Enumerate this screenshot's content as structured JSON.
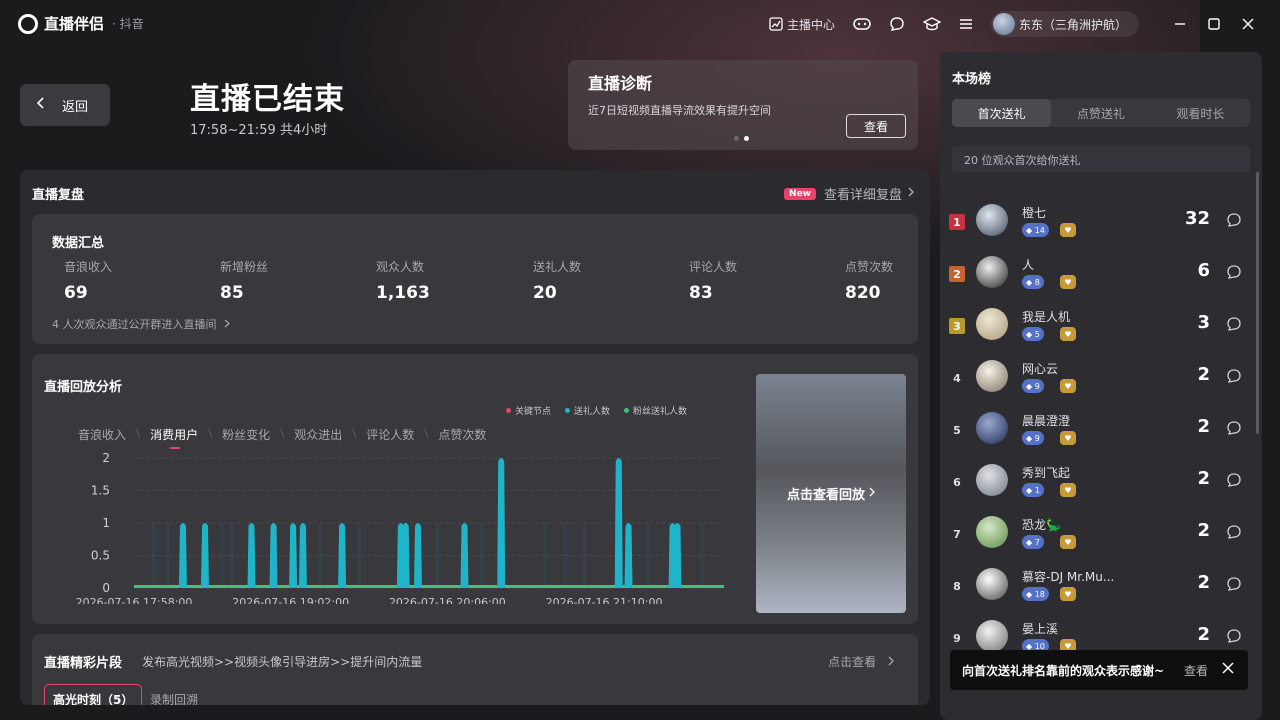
{
  "app": {
    "name": "直播伴侣",
    "platform": "· 抖音"
  },
  "titlebar": {
    "host_center": "主播中心",
    "user_name": "东东（三角洲护航）"
  },
  "back_label": "返回",
  "status": {
    "title": "直播已结束",
    "time_range": "17:58~21:59 共4小时"
  },
  "diagnosis": {
    "title": "直播诊断",
    "desc": "近7日短视频直播导流效果有提升空间",
    "button": "查看"
  },
  "review": {
    "title": "直播复盘",
    "new_badge": "New",
    "detail_link": "查看详细复盘"
  },
  "summary": {
    "title": "数据汇总",
    "stats": [
      {
        "label": "音浪收入",
        "value": "69"
      },
      {
        "label": "新增粉丝",
        "value": "85"
      },
      {
        "label": "观众人数",
        "value": "1,163"
      },
      {
        "label": "送礼人数",
        "value": "20"
      },
      {
        "label": "评论人数",
        "value": "83"
      },
      {
        "label": "点赞次数",
        "value": "820"
      }
    ],
    "note": "4 人次观众通过公开群进入直播间"
  },
  "analysis": {
    "title": "直播回放分析",
    "legend": [
      "关键节点",
      "送礼人数",
      "粉丝送礼人数"
    ],
    "tabs": [
      "音浪收入",
      "消费用户",
      "粉丝变化",
      "观众进出",
      "评论人数",
      "点赞次数"
    ],
    "active_tab": "消费用户",
    "replay_label": "点击查看回放"
  },
  "chart_data": {
    "type": "area",
    "y_ticks": [
      "2",
      "1.5",
      "1",
      "0.5",
      "0"
    ],
    "x_ticks": [
      "2026-07-16 17:58:00",
      "2026-07-16 19:02:00",
      "2026-07-16 20:06:00",
      "2026-07-16 21:10:00"
    ],
    "ylim": [
      0,
      2
    ],
    "xlim_minutes_from_start": [
      0,
      241
    ],
    "series": [
      {
        "name": "送礼人数",
        "color": "#1fb4c8",
        "spikes": [
          [
            20,
            1
          ],
          [
            29,
            1
          ],
          [
            48,
            1
          ],
          [
            57,
            1
          ],
          [
            65,
            1
          ],
          [
            69,
            1
          ],
          [
            85,
            1
          ],
          [
            109,
            1
          ],
          [
            111,
            1
          ],
          [
            116,
            1
          ],
          [
            135,
            1
          ],
          [
            150,
            2
          ],
          [
            198,
            2
          ],
          [
            202,
            1
          ],
          [
            220,
            1
          ],
          [
            222,
            1
          ]
        ]
      },
      {
        "name": "粉丝送礼人数",
        "color": "#3fc27a",
        "spikes": []
      }
    ],
    "colors": {
      "key_node": "#e8436a",
      "gift": "#1fb4c8",
      "fan_gift": "#3fc27a"
    }
  },
  "highlights": {
    "title": "直播精彩片段",
    "desc": "发布高光视频>>视频头像引导进房>>提升间内流量",
    "link": "点击查看",
    "tab_active": "高光时刻（5）",
    "tab_other": "录制回溯"
  },
  "ranking": {
    "title": "本场榜",
    "tabs": [
      "首次送礼",
      "点赞送礼",
      "观看时长"
    ],
    "note": "20 位观众首次给你送礼",
    "rows": [
      {
        "rank": "1",
        "name": "橙七",
        "level": "14",
        "count": "32"
      },
      {
        "rank": "2",
        "name": "人",
        "level": "8",
        "count": "6"
      },
      {
        "rank": "3",
        "name": "我是人机",
        "level": "5",
        "count": "3"
      },
      {
        "rank": "4",
        "name": "网心云",
        "level": "9",
        "count": "2"
      },
      {
        "rank": "5",
        "name": "晨晨澄澄",
        "level": "9",
        "count": "2"
      },
      {
        "rank": "6",
        "name": "秀到飞起",
        "level": "1",
        "count": "2"
      },
      {
        "rank": "7",
        "name": "恐龙🦕",
        "level": "7",
        "count": "2"
      },
      {
        "rank": "8",
        "name": "慕容-DJ Mr.Mu...",
        "level": "18",
        "count": "2"
      },
      {
        "rank": "9",
        "name": "晏上溪",
        "level": "10",
        "count": "2"
      }
    ]
  },
  "toast": {
    "text": "向首次送礼排名靠前的观众表示感谢~",
    "view": "查看"
  }
}
